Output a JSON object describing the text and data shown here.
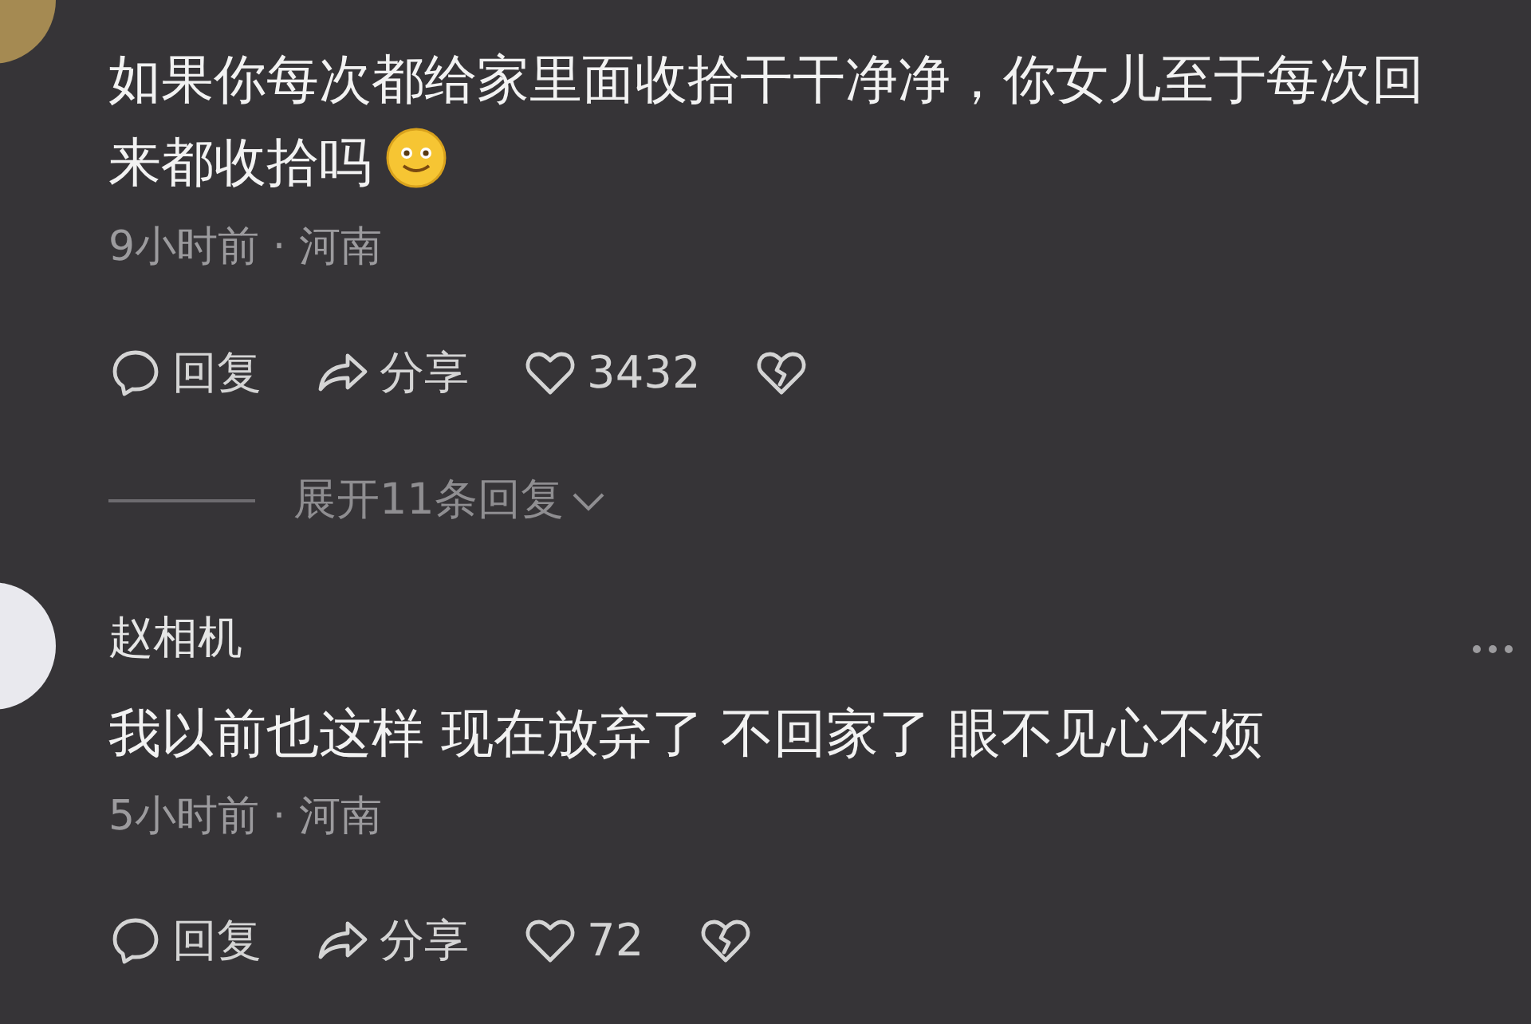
{
  "comments": [
    {
      "text": "如果你每次都给家里面收拾干干净净，你女儿至于每次回来都收拾吗",
      "emoji": true,
      "more_menu": false,
      "time": "9小时前",
      "separator": "·",
      "location": "河南",
      "reply_label": "回复",
      "share_label": "分享",
      "likes": "3432",
      "expand_replies": "展开11条回复"
    },
    {
      "author": "赵相机",
      "text": "我以前也这样 现在放弃了 不回家了 眼不见心不烦",
      "emoji": false,
      "more_menu": true,
      "time": "5小时前",
      "separator": "·",
      "location": "河南",
      "reply_label": "回复",
      "share_label": "分享",
      "likes": "72"
    }
  ]
}
